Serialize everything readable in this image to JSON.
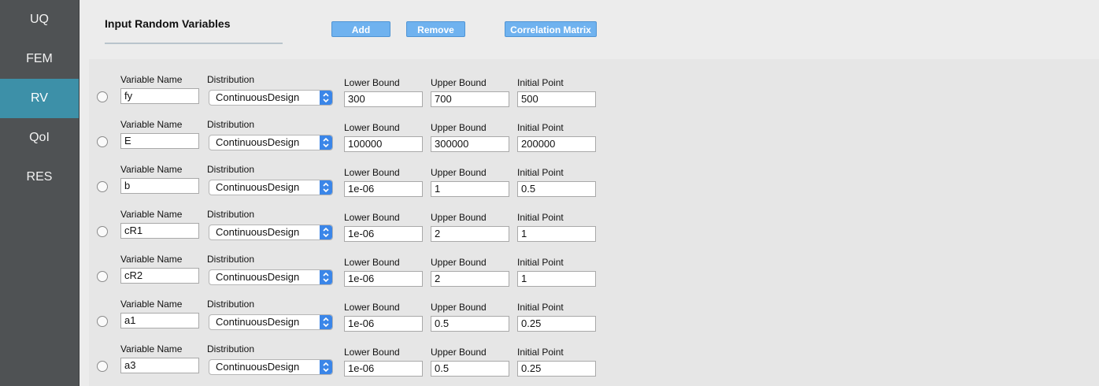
{
  "sidebar": {
    "items": [
      {
        "label": "UQ",
        "active": false
      },
      {
        "label": "FEM",
        "active": false
      },
      {
        "label": "RV",
        "active": true
      },
      {
        "label": "QoI",
        "active": false
      },
      {
        "label": "RES",
        "active": false
      }
    ]
  },
  "header": {
    "title": "Input Random Variables",
    "add_label": "Add",
    "remove_label": "Remove",
    "correlation_label": "Correlation Matrix"
  },
  "labels": {
    "variable_name": "Variable Name",
    "distribution": "Distribution",
    "lower_bound": "Lower Bound",
    "upper_bound": "Upper Bound",
    "initial_point": "Initial Point"
  },
  "rows": [
    {
      "name": "fy",
      "distribution": "ContinuousDesign",
      "lower": "300",
      "upper": "700",
      "initial": "500"
    },
    {
      "name": "E",
      "distribution": "ContinuousDesign",
      "lower": "100000",
      "upper": "300000",
      "initial": "200000"
    },
    {
      "name": "b",
      "distribution": "ContinuousDesign",
      "lower": "1e-06",
      "upper": "1",
      "initial": "0.5"
    },
    {
      "name": "cR1",
      "distribution": "ContinuousDesign",
      "lower": "1e-06",
      "upper": "2",
      "initial": "1"
    },
    {
      "name": "cR2",
      "distribution": "ContinuousDesign",
      "lower": "1e-06",
      "upper": "2",
      "initial": "1"
    },
    {
      "name": "a1",
      "distribution": "ContinuousDesign",
      "lower": "1e-06",
      "upper": "0.5",
      "initial": "0.25"
    },
    {
      "name": "a3",
      "distribution": "ContinuousDesign",
      "lower": "1e-06",
      "upper": "0.5",
      "initial": "0.25"
    }
  ],
  "colors": {
    "sidebar_bg": "#4f5254",
    "sidebar_active": "#3d90a8",
    "button_bg": "#6fb2ef",
    "select_arrow": "#3b86e8"
  }
}
